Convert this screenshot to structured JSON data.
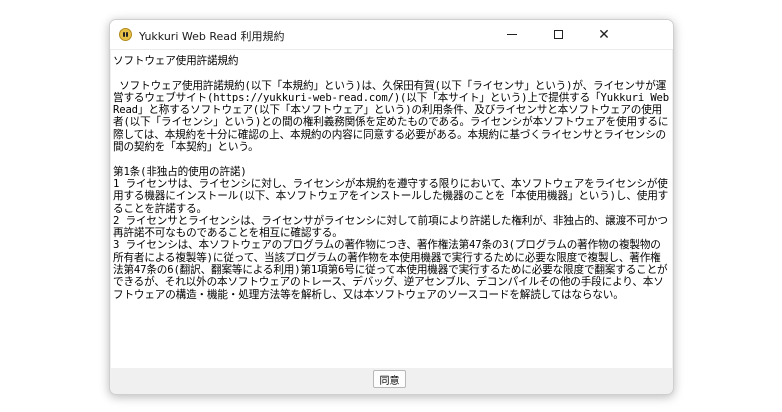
{
  "window": {
    "title": "Yukkuri Web Read 利用規約",
    "icon": "yukkuri-app-icon",
    "controls": {
      "minimize_icon": "minimize-icon",
      "maximize_icon": "maximize-icon",
      "close_icon": "close-icon",
      "close_glyph": "✕"
    }
  },
  "agreement": {
    "lines": [
      "ソフトウェア使用許諾規約",
      "",
      " ソフトウェア使用許諾規約(以下「本規約」という)は、久保田有賀(以下「ライセンサ」という)が、ライセンサが運営するウェブサイト(https://yukkuri-web-read.com/)(以下「本サイト」という)上で提供する「Yukkuri Web Read」と称するソフトウェア(以下「本ソフトウェア」という)の利用条件、及びライセンサと本ソフトウェアの使用者(以下「ライセンシ」という)との間の権利義務関係を定めたものである。ライセンシが本ソフトウェアを使用するに際しては、本規約を十分に確認の上、本規約の内容に同意する必要がある。本規約に基づくライセンサとライセンシの間の契約を「本契約」という。",
      "",
      "第1条(非独占的使用の許諾)",
      "1 ライセンサは、ライセンシに対し、ライセンシが本規約を遵守する限りにおいて、本ソフトウェアをライセンシが使用する機器にインストール(以下、本ソフトウェアをインストールした機器のことを「本使用機器」という)し、使用することを許諾する。",
      "2 ライセンサとライセンシは、ライセンサがライセンシに対して前項により許諾した権利が、非独占的、譲渡不可かつ再許諾不可なものであることを相互に確認する。",
      "3 ライセンシは、本ソフトウェアのプログラムの著作物につき、著作権法第47条の3(プログラムの著作物の複製物の所有者による複製等)に従って、当該プログラムの著作物を本使用機器で実行するために必要な限度で複製し、著作権法第47条の6(翻訳、翻案等による利用)第1項第6号に従って本使用機器で実行するために必要な限度で翻案することができるが、それ以外の本ソフトウェアのトレース、デバッグ、逆アセンブル、デコンパイルその他の手段により、本ソフトウェアの構造・機能・処理方法等を解析し、又は本ソフトウェアのソースコードを解読してはならない。"
    ]
  },
  "footer": {
    "agree_label": "同意"
  }
}
